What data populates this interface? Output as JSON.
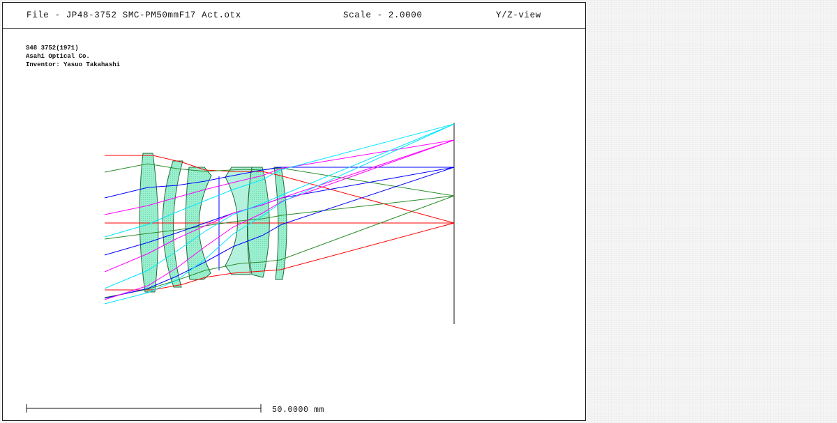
{
  "header": {
    "file_label": "File - JP48-3752 SMC-PM50mmF17 Act.otx",
    "scale_label": "Scale - 2.0000",
    "view_label": "Y/Z-view"
  },
  "notes": {
    "line1": "S48 3752(1971)",
    "line2": "Asahi Optical Co.",
    "line3": "Inventor: Yasuo Takahashi"
  },
  "scale_bar": {
    "label": "50.0000 mm"
  },
  "colors": {
    "lens_fill": "#8fe8c4",
    "lens_stroke": "#1d6b3a",
    "ray_field_0": "#ff0000",
    "ray_field_1": "#2a8c2a",
    "ray_field_2": "#0000ff",
    "ray_field_3": "#ff00ff",
    "ray_field_4": "#00e5ff",
    "line": "#111111"
  }
}
